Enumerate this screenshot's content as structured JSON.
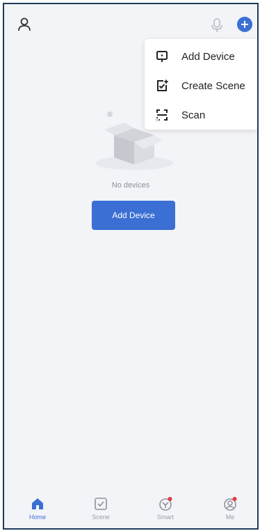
{
  "header": {
    "user_icon": "user-icon",
    "mic_icon": "microphone-icon",
    "add_icon": "add-circle-icon",
    "accent": "#3b6fd4"
  },
  "menu": {
    "items": [
      {
        "label": "Add Device",
        "icon": "device-icon"
      },
      {
        "label": "Create Scene",
        "icon": "create-scene-icon"
      },
      {
        "label": "Scan",
        "icon": "scan-icon"
      }
    ]
  },
  "empty": {
    "message": "No devices",
    "button_label": "Add Device",
    "illustration": "empty-box-illustration"
  },
  "tabs": [
    {
      "label": "Home",
      "icon": "home-icon",
      "active": true,
      "badge": false
    },
    {
      "label": "Scene",
      "icon": "scene-icon",
      "active": false,
      "badge": false
    },
    {
      "label": "Smart",
      "icon": "smart-icon",
      "active": false,
      "badge": true
    },
    {
      "label": "Me",
      "icon": "me-icon",
      "active": false,
      "badge": true
    }
  ],
  "colors": {
    "accent": "#3b6fd4",
    "badge": "#e23b3b",
    "background": "#f3f4f8"
  }
}
